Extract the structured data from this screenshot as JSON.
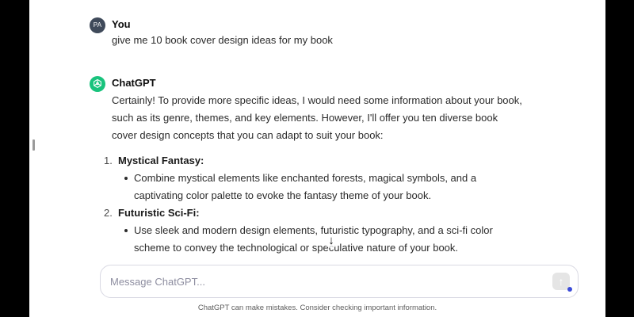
{
  "conversation": {
    "user": {
      "avatar_initials": "PA",
      "author": "You",
      "text": "give me 10 book cover design ideas for my book"
    },
    "assistant": {
      "avatar_icon": "openai-logo-icon",
      "author": "ChatGPT",
      "intro": "Certainly! To provide more specific ideas, I would need some information about your book, such as its genre, themes, and key elements. However, I'll offer you ten diverse book cover design concepts that you can adapt to suit your book:",
      "ideas": [
        {
          "number": "1.",
          "title": "Mystical Fantasy:",
          "bullets": [
            "Combine mystical elements like enchanted forests, magical symbols, and a captivating color palette to evoke the fantasy theme of your book."
          ]
        },
        {
          "number": "2.",
          "title": "Futuristic Sci-Fi:",
          "bullets": [
            "Use sleek and modern design elements, futuristic typography, and a sci-fi color scheme to convey the technological or speculative nature of your book."
          ]
        }
      ]
    }
  },
  "scroll_down_icon": "arrow-down-icon",
  "composer": {
    "placeholder": "Message ChatGPT...",
    "send_icon": "arrow-up-icon"
  },
  "footer": {
    "disclaimer": "ChatGPT can make mistakes. Consider checking important information."
  },
  "colors": {
    "assistant_avatar": "#19c37d",
    "user_avatar": "#3f4a5a",
    "send_button_disabled": "#e5e5e5",
    "status_dot": "#3b4bd8"
  }
}
